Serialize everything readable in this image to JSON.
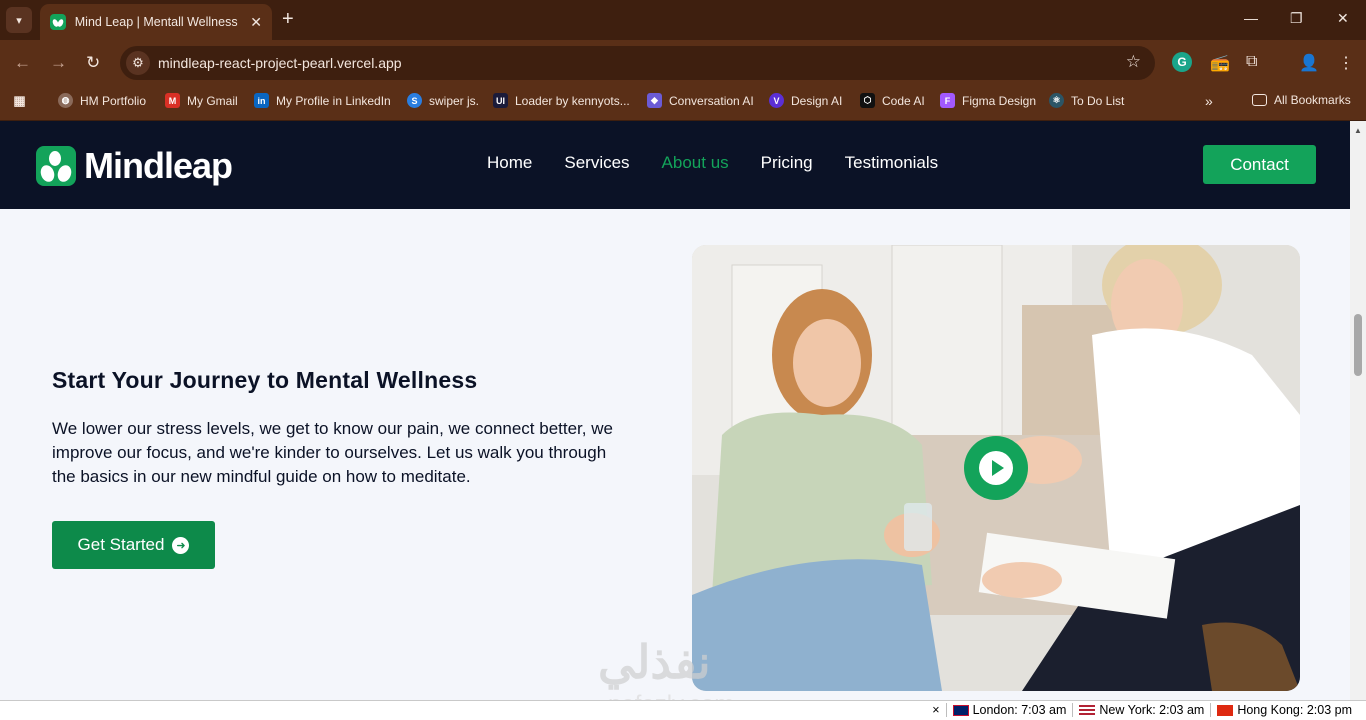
{
  "browser": {
    "tab_title": "Mind Leap | Mentall Wellness R",
    "url": "mindleap-react-project-pearl.vercel.app",
    "bookmarks": [
      {
        "label": "HM Portfolio"
      },
      {
        "label": "My Gmail"
      },
      {
        "label": "My Profile in LinkedIn"
      },
      {
        "label": "swiper js."
      },
      {
        "label": "Loader by kennyots..."
      },
      {
        "label": "Conversation AI"
      },
      {
        "label": "Design AI"
      },
      {
        "label": "Code AI"
      },
      {
        "label": "Figma Design"
      },
      {
        "label": "To Do List"
      }
    ],
    "all_bookmarks": "All Bookmarks"
  },
  "site": {
    "brand": "Mindleap",
    "menu": [
      "Home",
      "Services",
      "About us",
      "Pricing",
      "Testimonials"
    ],
    "active_menu": "About us",
    "contact_label": "Contact",
    "hero": {
      "title": "Start Your Journey to Mental Wellness",
      "text": "We lower our stress levels, we get to know our pain, we connect better, we improve our focus, and we're kinder to ourselves. Let us walk you through the basics in our new mindful guide on how to meditate.",
      "cta_label": "Get Started"
    },
    "accent_color": "#13a35a",
    "nav_color": "#0b1226"
  },
  "watermark": {
    "arabic": "نفذلي",
    "latin": "nafezly.com"
  },
  "status_bar": {
    "clocks": [
      "London: 7:03 am",
      "New York: 2:03 am",
      "Hong Kong: 2:03 pm"
    ]
  }
}
